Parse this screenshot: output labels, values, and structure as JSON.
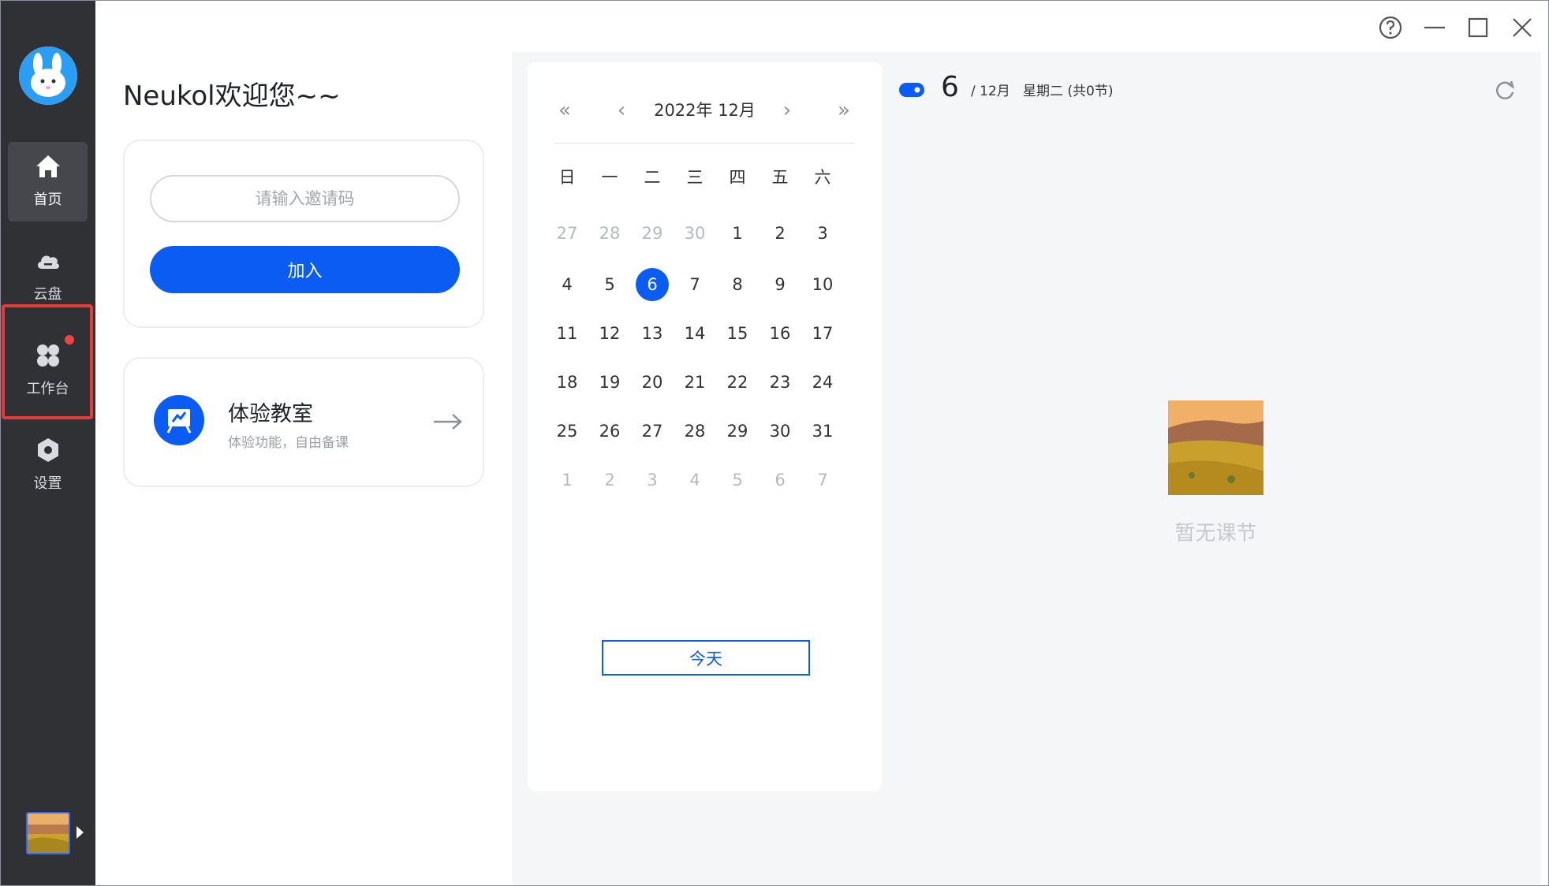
{
  "sidebar": {
    "items": [
      {
        "label": "首页",
        "icon": "home-icon",
        "active": true
      },
      {
        "label": "云盘",
        "icon": "cloud-icon",
        "active": false
      },
      {
        "label": "工作台",
        "icon": "workbench-icon",
        "active": false,
        "badge": true
      },
      {
        "label": "设置",
        "icon": "settings-icon",
        "active": false
      }
    ]
  },
  "main": {
    "welcome": "Neukol欢迎您~~",
    "invite": {
      "placeholder": "请输入邀请码",
      "join_label": "加入"
    },
    "trial": {
      "title": "体验教室",
      "subtitle": "体验功能，自由备课"
    }
  },
  "calendar": {
    "month_label": "2022年 12月",
    "weekdays": [
      "日",
      "一",
      "二",
      "三",
      "四",
      "五",
      "六"
    ],
    "weeks": [
      [
        [
          "27",
          true
        ],
        [
          "28",
          true
        ],
        [
          "29",
          true
        ],
        [
          "30",
          true
        ],
        [
          "1",
          false
        ],
        [
          "2",
          false
        ],
        [
          "3",
          false
        ]
      ],
      [
        [
          "4",
          false
        ],
        [
          "5",
          false
        ],
        [
          "6",
          false
        ],
        [
          "7",
          false
        ],
        [
          "8",
          false
        ],
        [
          "9",
          false
        ],
        [
          "10",
          false
        ]
      ],
      [
        [
          "11",
          false
        ],
        [
          "12",
          false
        ],
        [
          "13",
          false
        ],
        [
          "14",
          false
        ],
        [
          "15",
          false
        ],
        [
          "16",
          false
        ],
        [
          "17",
          false
        ]
      ],
      [
        [
          "18",
          false
        ],
        [
          "19",
          false
        ],
        [
          "20",
          false
        ],
        [
          "21",
          false
        ],
        [
          "22",
          false
        ],
        [
          "23",
          false
        ],
        [
          "24",
          false
        ]
      ],
      [
        [
          "25",
          false
        ],
        [
          "26",
          false
        ],
        [
          "27",
          false
        ],
        [
          "28",
          false
        ],
        [
          "29",
          false
        ],
        [
          "30",
          false
        ],
        [
          "31",
          false
        ]
      ],
      [
        [
          "1",
          true
        ],
        [
          "2",
          true
        ],
        [
          "3",
          true
        ],
        [
          "4",
          true
        ],
        [
          "5",
          true
        ],
        [
          "6",
          true
        ],
        [
          "7",
          true
        ]
      ]
    ],
    "selected_day": "6",
    "today_label": "今天"
  },
  "schedule": {
    "day_number": "6",
    "month_part": "/ 12月",
    "weekday_part": "星期二 (共0节)",
    "empty_text": "暂无课节"
  },
  "colors": {
    "accent": "#0b5cf2",
    "sidebar": "#2f3135",
    "badge": "#f04343",
    "highlight": "#e83a3a"
  }
}
